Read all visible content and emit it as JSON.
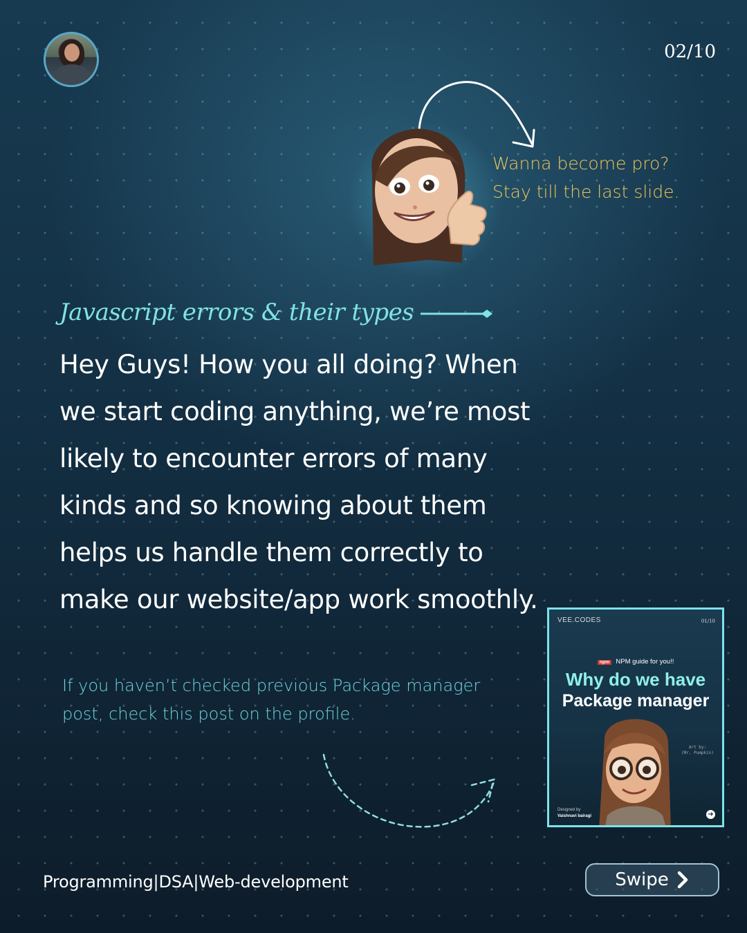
{
  "header": {
    "page_indicator": "02/10",
    "avatar_icon": "profile-photo"
  },
  "callout": {
    "line1": "Wanna become pro?",
    "line2": "Stay till the last slide.",
    "color": "#f0c55b",
    "memoji_icon": "memoji-thumbs-up"
  },
  "main": {
    "subtitle": "Javascript errors & their types",
    "body": "Hey Guys! How you all doing? When we start coding anything, we’re most likely to encounter errors of many kinds and so knowing about them helps us handle them correctly to make our website/app work smoothly.",
    "note": "If you haven’t checked previous Package manager post, check this post on the profile.",
    "accent": "#7fe3e2"
  },
  "thumbnail": {
    "brand": "VEE.CODES",
    "page": "01/10",
    "npm_badge": "npm",
    "guide": "NPM guide for you!!",
    "title_line1": "Why do we have",
    "title_line2": "Package manager",
    "art_by_line1": "Art by:",
    "art_by_line2": "(Mr. Pumpkin)",
    "designed_by": "Designed by",
    "designer": "Vaishnavi bairagi"
  },
  "footer": {
    "tagline": "Programming|DSA|Web-development",
    "swipe_label": "Swipe"
  }
}
